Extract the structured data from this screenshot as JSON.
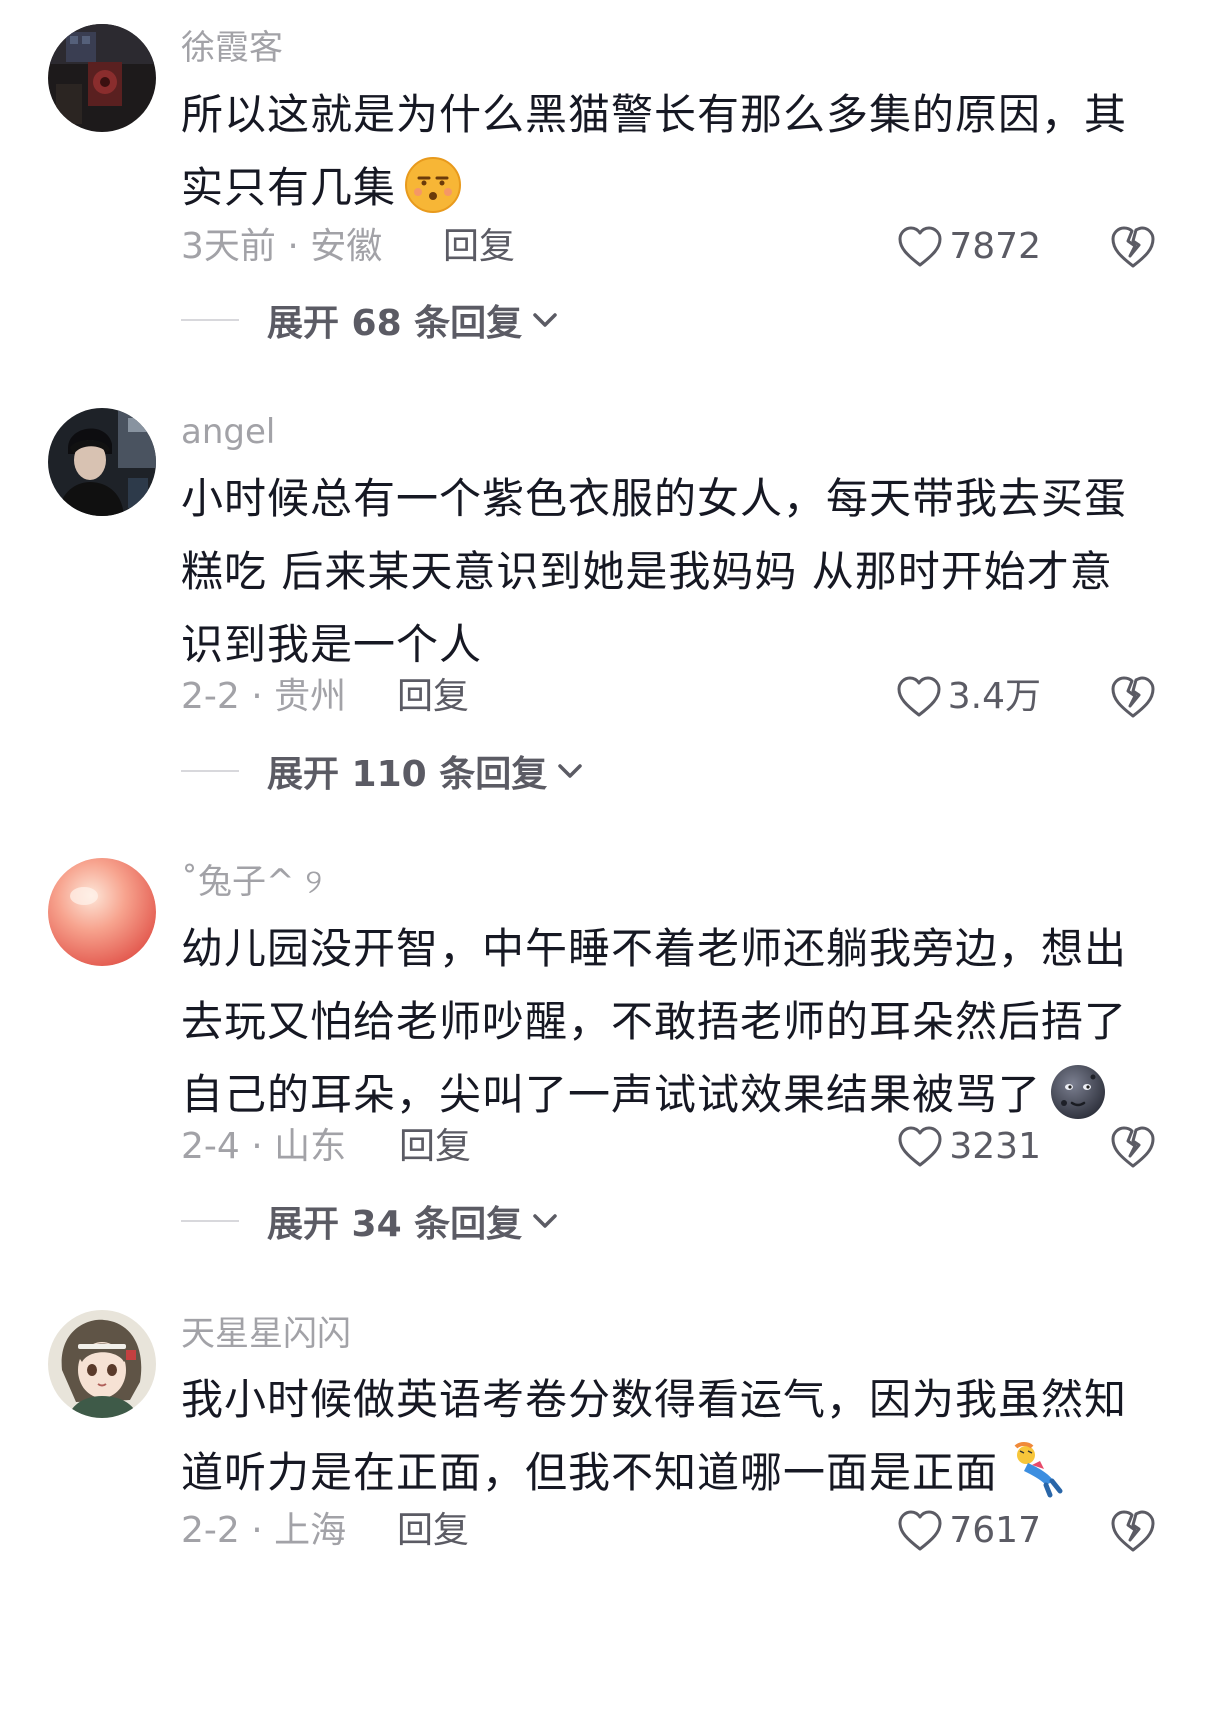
{
  "comments": [
    {
      "username": "徐霞客",
      "avatar_icon": "avatar-dark-room-icon",
      "text": "所以这就是为什么黑猫警长有那么多集的原因，其实只有几集",
      "emoji_icon": "unamused-face-emoji-icon",
      "time_location": "3天前 · 安徽",
      "reply_label": "回复",
      "likes": "7872",
      "expand_label": "展开 68 条回复"
    },
    {
      "username": "angel",
      "avatar_icon": "avatar-person-dark-icon",
      "text": "小时候总有一个紫色衣服的女人，每天带我去买蛋糕吃 后来某天意识到她是我妈妈 从那时开始才意识到我是一个人",
      "time_location": "2-2 · 贵州",
      "reply_label": "回复",
      "likes": "3.4万",
      "expand_label": "展开 110 条回复"
    },
    {
      "username": "˚兔子^ ୨",
      "avatar_icon": "avatar-peach-icon",
      "text": "幼儿园没开智，中午睡不着老师还躺我旁边，想出去玩又怕给老师吵醒，不敢捂老师的耳朵然后捂了自己的耳朵，尖叫了一声试试效果结果被骂了",
      "emoji_icon": "new-moon-face-emoji-icon",
      "time_location": "2-4 · 山东",
      "reply_label": "回复",
      "likes": "3231",
      "expand_label": "展开 34 条回复"
    },
    {
      "username": "天星星闪闪",
      "avatar_icon": "avatar-anime-girl-icon",
      "text": "我小时候做英语考卷分数得看运气，因为我虽然知道听力是在正面，但我不知道哪一面是正面",
      "emoji_icon": "falling-person-emoji-icon",
      "time_location": "2-2 · 上海",
      "reply_label": "回复",
      "likes": "7617"
    }
  ],
  "colors": {
    "text_primary": "#161823",
    "text_secondary": "#a2a2a7",
    "text_action": "#5b5b64"
  }
}
